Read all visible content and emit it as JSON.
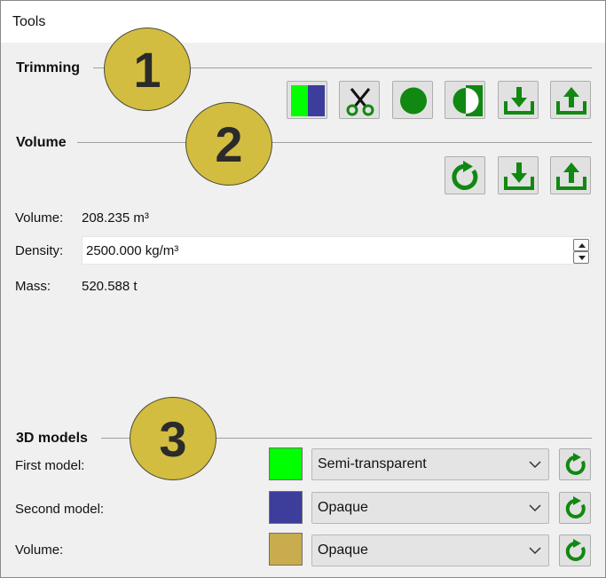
{
  "window": {
    "title": "Tools"
  },
  "trimming": {
    "title": "Trimming",
    "badge": "1",
    "buttons": [
      {
        "icon": "split-color-icon"
      },
      {
        "icon": "scissors-icon"
      },
      {
        "icon": "circle-icon"
      },
      {
        "icon": "half-circle-icon"
      },
      {
        "icon": "download-icon"
      },
      {
        "icon": "upload-icon"
      }
    ]
  },
  "volume": {
    "title": "Volume",
    "badge": "2",
    "buttons": [
      {
        "icon": "refresh-icon"
      },
      {
        "icon": "download-icon"
      },
      {
        "icon": "upload-icon"
      }
    ],
    "volume_label": "Volume:",
    "volume_value": "208.235 m³",
    "density_label": "Density:",
    "density_value": "2500.000 kg/m³",
    "mass_label": "Mass:",
    "mass_value": "520.588 t"
  },
  "models": {
    "title": "3D models",
    "badge": "3",
    "rows": [
      {
        "label": "First model:",
        "color": "#00ff00",
        "mode": "Semi-transparent"
      },
      {
        "label": "Second model:",
        "color": "#3d3d9c",
        "mode": "Opaque"
      },
      {
        "label": "Volume:",
        "color": "#c8ac4e",
        "mode": "Opaque"
      }
    ]
  },
  "colors": {
    "icon_green": "#118811",
    "badge_fill": "#d2bd40"
  }
}
